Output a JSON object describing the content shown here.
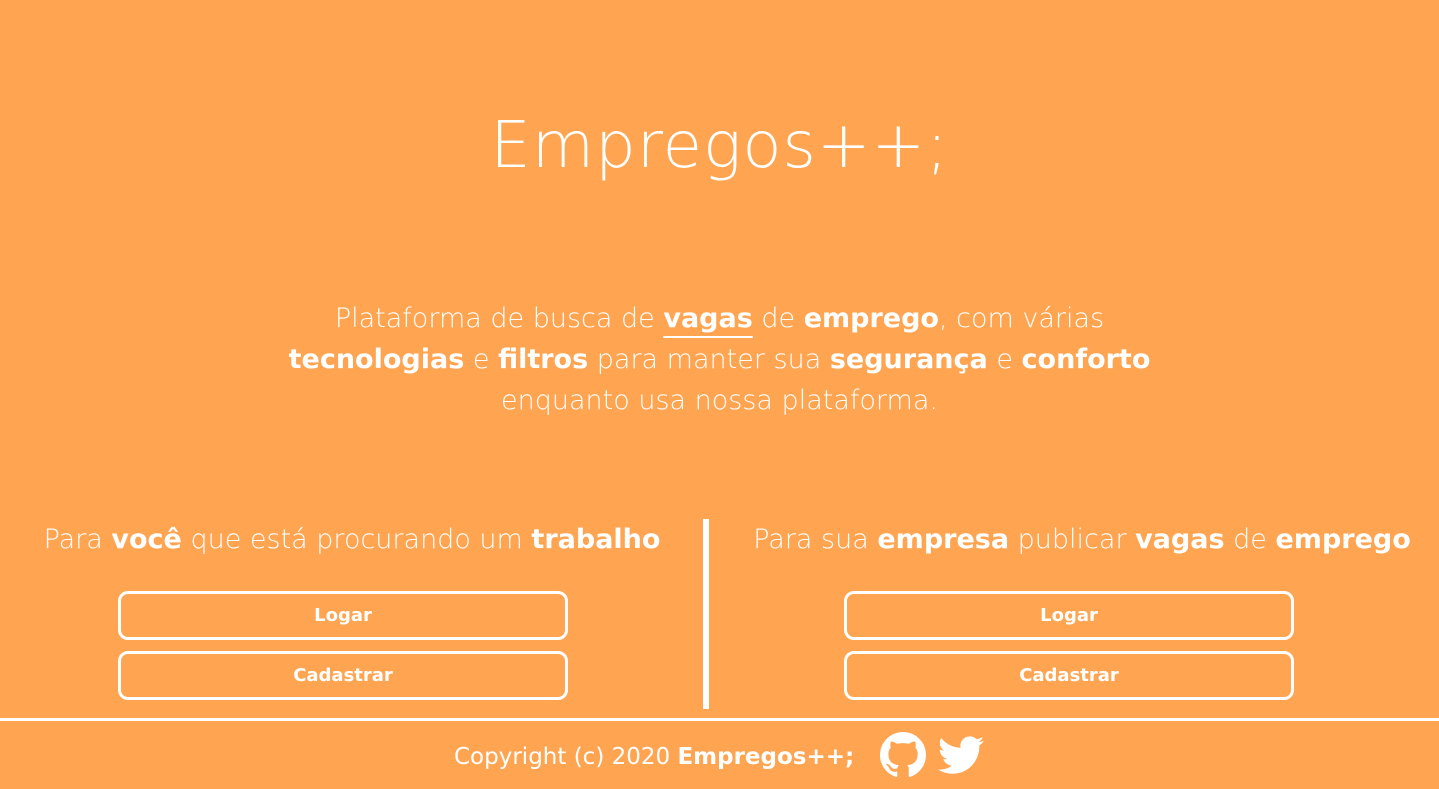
{
  "header": {
    "title": "Empregos++;"
  },
  "tagline": {
    "t1": "Plataforma de busca de ",
    "vagas": "vagas",
    "t2": " de ",
    "emprego": "emprego",
    "t3": ", com várias",
    "tecnologias": "tecnologias",
    "t4": " e ",
    "filtros": "filtros",
    "t5": " para manter sua ",
    "seguranca": "segurança",
    "t6": " e ",
    "conforto": "conforto",
    "t7": "enquanto usa nossa plataforma."
  },
  "candidate": {
    "h1": "Para ",
    "voce": "você",
    "h2": " que está procurando um ",
    "trabalho": "trabalho",
    "login_label": "Logar",
    "signup_label": "Cadastrar"
  },
  "company": {
    "h1": "Para sua ",
    "empresa": "empresa",
    "h2": " publicar ",
    "vagas": "vagas",
    "h3": " de ",
    "emprego": "emprego",
    "login_label": "Logar",
    "signup_label": "Cadastrar"
  },
  "footer": {
    "copyright_prefix": "Copyright (c) 2020 ",
    "brand": "Empregos++;",
    "icons": [
      "github-icon",
      "twitter-icon"
    ]
  },
  "colors": {
    "background": "#FFA552",
    "foreground": "#FFFFFF"
  }
}
